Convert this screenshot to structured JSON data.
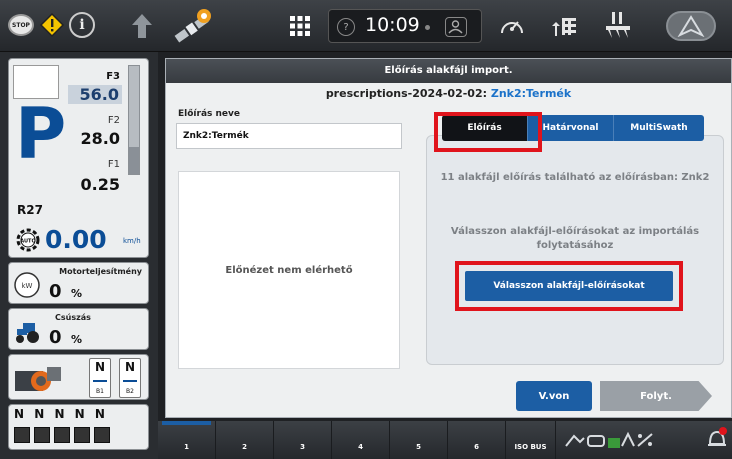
{
  "topbar": {
    "stop_label": "STOP",
    "time": "10:09",
    "help_symbol": "?",
    "info_symbol": "i",
    "icons": [
      "stop-icon",
      "warning-icon",
      "info-icon",
      "up-arrow-icon",
      "satellite-icon",
      "apps-grid-icon",
      "help-icon",
      "user-icon",
      "gauge-icon",
      "row-control-icon",
      "implement-icon",
      "auto-steer-icon"
    ],
    "accent_color": "#1c5ea4",
    "warning_color": "#f5c400"
  },
  "left": {
    "gear": "P",
    "range": "R27",
    "f3_label": "F3",
    "f3_value": "56.0",
    "f2_label": "F2",
    "f2_value": "28.0",
    "f1_label": "F1",
    "f1_value": "0.25",
    "gear_level_fraction": 0.25,
    "speed": "0.00",
    "speed_unit": "km/h",
    "engine_title": "Motorteljesítmény",
    "engine_value": "0",
    "engine_unit": "%",
    "engine_icon_text": "kW",
    "slip_title": "Csúszás",
    "slip_value": "0",
    "slip_unit": "%",
    "neutral_b1": "N",
    "neutral_b1_label": "B1",
    "neutral_b2": "N",
    "neutral_b2_label": "B2",
    "valves_label": "N N N N N"
  },
  "dialog": {
    "title": "Előírás alakfájl import.",
    "subtitle_prefix": "prescriptions-2024-02-02: ",
    "subtitle_link": "Znk2:Termék",
    "name_label": "Előírás neve",
    "name_value": "Znk2:Termék",
    "preview_text": "Előnézet nem elérhető",
    "tabs": [
      {
        "label": "Előírás",
        "active": true
      },
      {
        "label": "Határvonal",
        "active": false
      },
      {
        "label": "MultiSwath",
        "active": false
      }
    ],
    "info1": "11 alakfájl előírás található az előírásban: Znk2",
    "info2": "Válasszon alakfájl-előírásokat az importálás folytatásához",
    "select_button": "Válasszon alakfájl-előírásokat",
    "back_button": "V.von",
    "next_button": "Folyt.",
    "highlight_color": "#e0141c"
  },
  "bottom": {
    "tabs": [
      "1",
      "2",
      "3",
      "4",
      "5",
      "6",
      "ISO BUS"
    ],
    "selected_tab": "1"
  }
}
